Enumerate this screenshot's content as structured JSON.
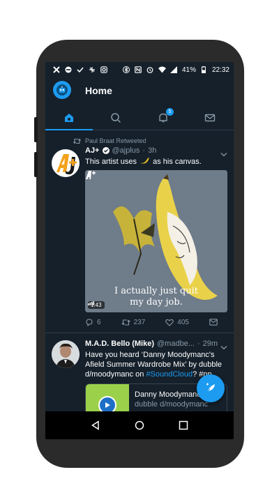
{
  "status_bar": {
    "battery": "41%",
    "time": "22:32",
    "left_icons": [
      "notification-x-icon",
      "block-icon",
      "check-icon",
      "sync-icon",
      "instagram-icon"
    ],
    "right_icons": [
      "bluetooth-icon",
      "nfc-icon",
      "alarm-icon",
      "wifi-icon",
      "signal-icon",
      "battery-icon"
    ]
  },
  "header": {
    "title": "Home"
  },
  "tabs": [
    {
      "icon": "home-icon",
      "active": true
    },
    {
      "icon": "search-icon",
      "active": false
    },
    {
      "icon": "bell-icon",
      "active": false,
      "badge": "5"
    },
    {
      "icon": "mail-icon",
      "active": false
    }
  ],
  "tweets": [
    {
      "retweet_label": "Paul Braat Retweeted",
      "name": "AJ+",
      "verified": true,
      "handle": "@ajplus",
      "time": "3h",
      "text_before": "This artist uses",
      "text_after": "as his canvas.",
      "emoji_icon": "banana-icon",
      "media": {
        "caption_line1": "I actually just quit",
        "caption_line2": "my day job.",
        "duration": "1:43",
        "watermark": "AJ+"
      },
      "replies": "6",
      "retweets": "237",
      "likes": "405"
    },
    {
      "name": "M.A.D. Bello (Mike)",
      "handle": "@madbe...",
      "time": "29m",
      "text": "Have you heard ‘Danny Moodymanc's Afield Summer Wardrobe Mix’ by dubble d/moodymanc on ",
      "hashtag": "#SoundCloud",
      "text_tail": "? #np",
      "card_title": "Danny Moodymanc",
      "card_subtitle": "dubble d/moodymanc"
    }
  ],
  "colors": {
    "background": "#15202b",
    "accent": "#1d9bf0",
    "muted": "#8899a6"
  }
}
